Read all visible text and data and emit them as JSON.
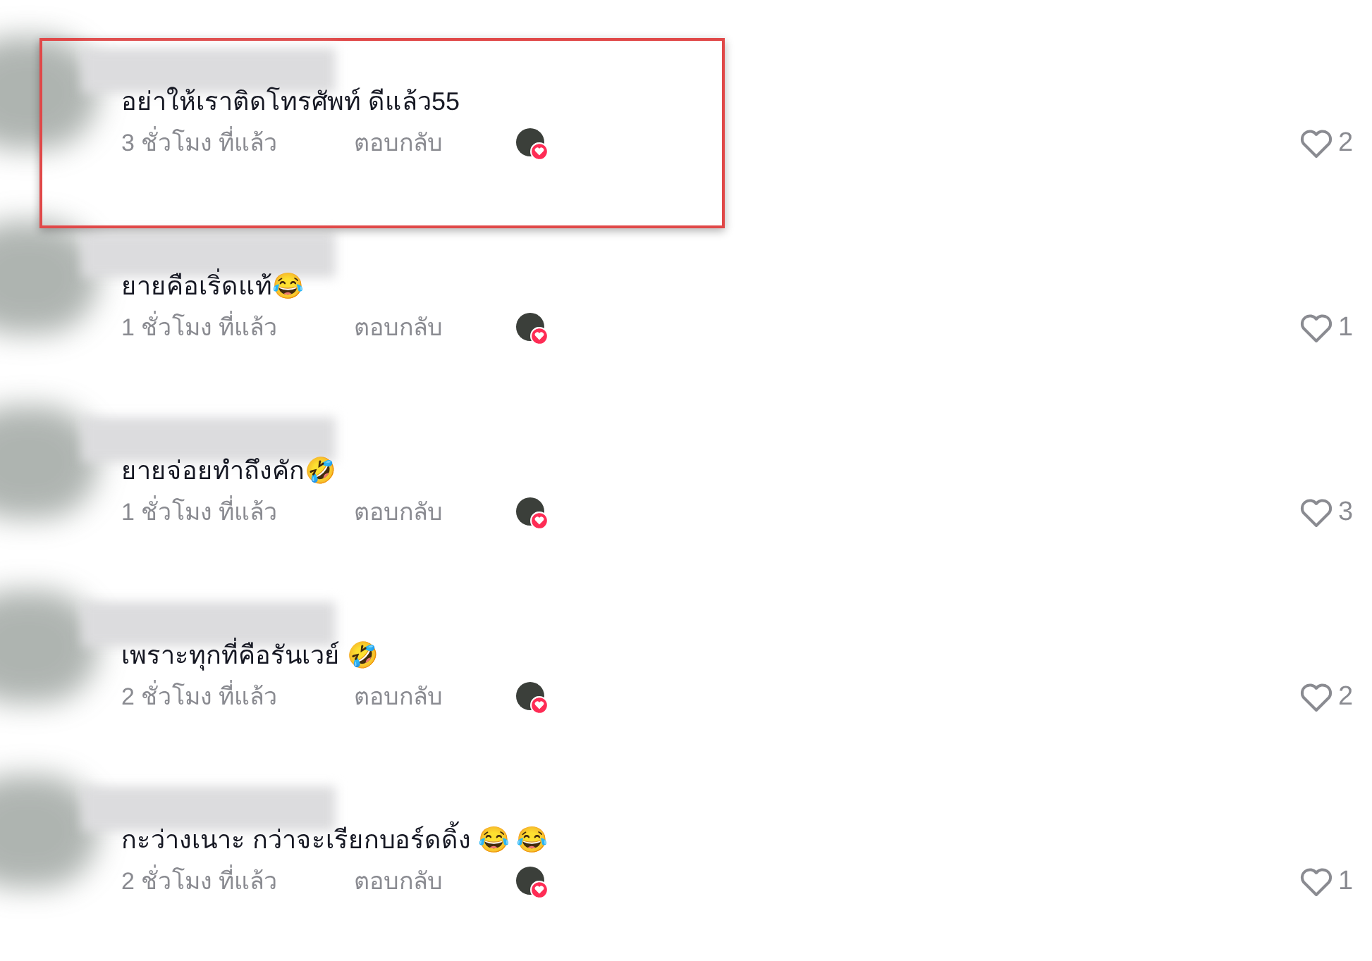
{
  "comments": [
    {
      "text": "อย่าให้เราติดโทรศัพท์ ดีแล้ว55",
      "time": "3 ชั่วโมง ที่แล้ว",
      "reply": "ตอบกลับ",
      "likes": "2",
      "highlighted": true
    },
    {
      "text": "ยายคือเริ่ดแท้😂",
      "time": "1 ชั่วโมง ที่แล้ว",
      "reply": "ตอบกลับ",
      "likes": "1",
      "highlighted": false
    },
    {
      "text": "ยายจ่อยทำถึงคัก🤣",
      "time": "1 ชั่วโมง ที่แล้ว",
      "reply": "ตอบกลับ",
      "likes": "3",
      "highlighted": false
    },
    {
      "text": "เพราะทุกที่คือรันเวย์ 🤣",
      "time": "2 ชั่วโมง ที่แล้ว",
      "reply": "ตอบกลับ",
      "likes": "2",
      "highlighted": false
    },
    {
      "text": "กะว่างเนาะ กว่าจะเรียกบอร์ดดิ้ง 😂 😂",
      "time": "2 ชั่วโมง ที่แล้ว",
      "reply": "ตอบกลับ",
      "likes": "1",
      "highlighted": false
    }
  ]
}
